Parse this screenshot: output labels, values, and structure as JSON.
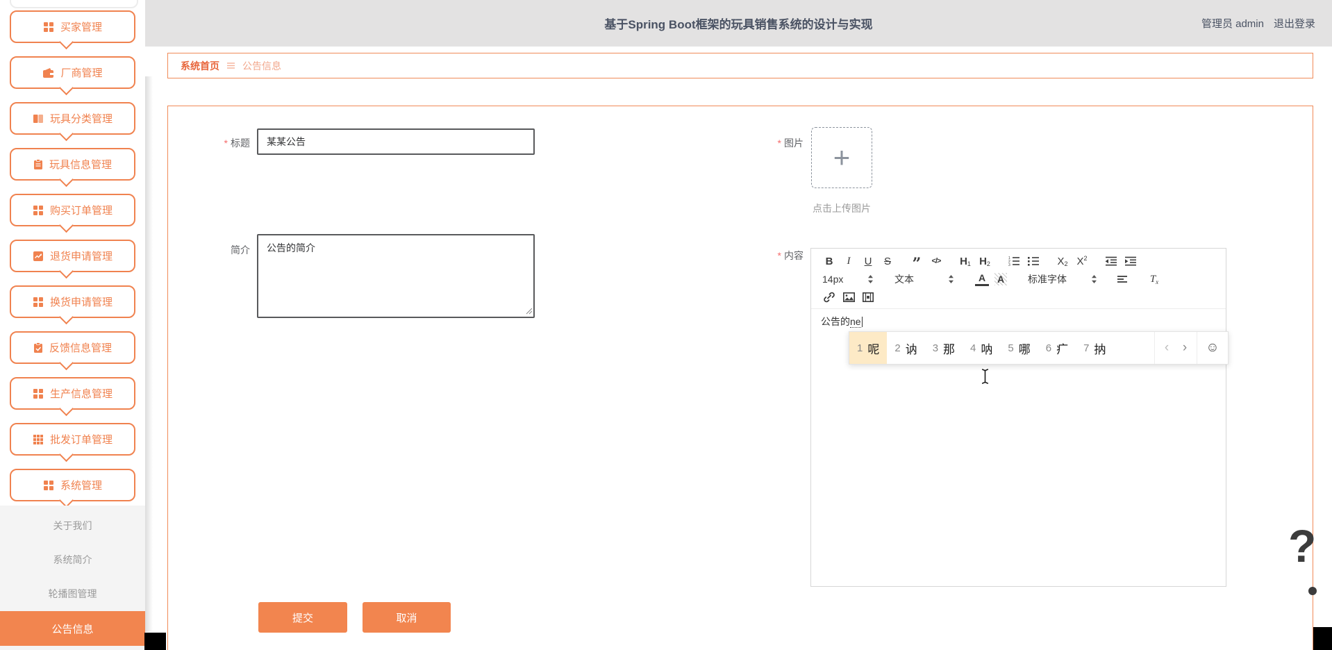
{
  "header": {
    "title": "基于Spring Boot框架的玩具销售系统的设计与实现",
    "user": "管理员 admin",
    "logout_label": "退出登录"
  },
  "breadcrumb": {
    "home": "系统首页",
    "current": "公告信息"
  },
  "sidebar": {
    "items": [
      {
        "label": "买家管理",
        "icon": "grid-icon"
      },
      {
        "label": "厂商管理",
        "icon": "wallet-icon"
      },
      {
        "label": "玩具分类管理",
        "icon": "book-icon"
      },
      {
        "label": "玩具信息管理",
        "icon": "clipboard-icon"
      },
      {
        "label": "购买订单管理",
        "icon": "grid-icon"
      },
      {
        "label": "退货申请管理",
        "icon": "chart-icon"
      },
      {
        "label": "换货申请管理",
        "icon": "grid-icon"
      },
      {
        "label": "反馈信息管理",
        "icon": "clipboard-check-icon"
      },
      {
        "label": "生产信息管理",
        "icon": "grid-icon"
      },
      {
        "label": "批发订单管理",
        "icon": "grid9-icon"
      },
      {
        "label": "系统管理",
        "icon": "grid-icon"
      }
    ],
    "submenu": [
      {
        "label": "关于我们",
        "active": false
      },
      {
        "label": "系统简介",
        "active": false
      },
      {
        "label": "轮播图管理",
        "active": false
      },
      {
        "label": "公告信息",
        "active": true
      }
    ]
  },
  "form": {
    "required_mark": "*",
    "title_label": "标题",
    "title_value": "某某公告",
    "image_label": "图片",
    "upload_plus": "+",
    "upload_hint": "点击上传图片",
    "intro_label": "简介",
    "intro_value": "公告的简介",
    "content_label": "内容",
    "submit_label": "提交",
    "cancel_label": "取消"
  },
  "editor": {
    "toolbar": {
      "bold": "B",
      "italic": "I",
      "underline": "U",
      "strike": "S",
      "quote": "”",
      "code": "</>",
      "h": "H",
      "h1": "1",
      "h2": "2",
      "x": "X",
      "sub": "2",
      "sup": "2",
      "font_size": "14px",
      "format": "文本",
      "font_family": "标准字体",
      "color_a": "A",
      "bg_a": "A",
      "clear_t": "T",
      "clear_x": "x"
    },
    "content": {
      "typed": "公告的",
      "composition": "ne"
    }
  },
  "ime": {
    "candidates": [
      {
        "num": "1",
        "char": "呢",
        "active": true
      },
      {
        "num": "2",
        "char": "讷",
        "active": false
      },
      {
        "num": "3",
        "char": "那",
        "active": false
      },
      {
        "num": "4",
        "char": "呐",
        "active": false
      },
      {
        "num": "5",
        "char": "哪",
        "active": false
      },
      {
        "num": "6",
        "char": "疒",
        "active": false
      },
      {
        "num": "7",
        "char": "抐",
        "active": false
      }
    ],
    "prev_arrow": "‹",
    "next_arrow": "›",
    "emoji_face": "☺"
  },
  "artifacts": {
    "question_mark": "?"
  },
  "colors": {
    "accent": "#f2854f",
    "sidebar_border": "#f0824f",
    "header_bg": "#e3e2e2",
    "header_text": "#4a5263",
    "dark_input_border": "#58595b",
    "required": "#f56c6c",
    "ime_highlight": "#fdeac6"
  }
}
